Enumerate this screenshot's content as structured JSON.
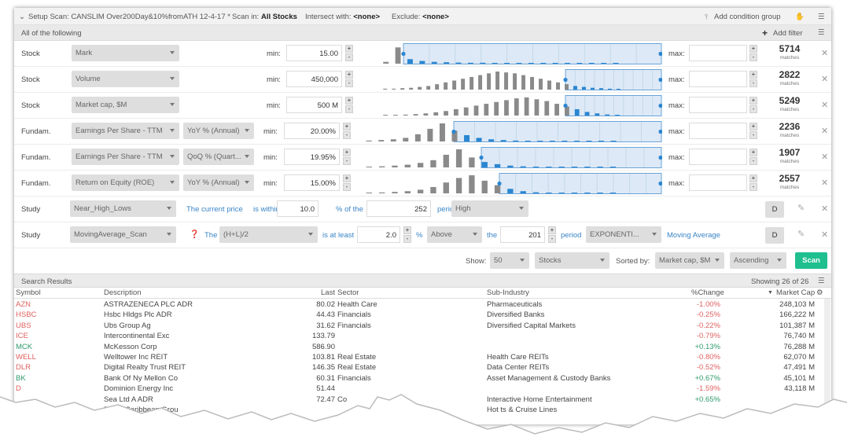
{
  "topbar": {
    "setup_label": "Setup Scan: CANSLIM Over200Day&10%fromATH 12-4-17 *",
    "scan_in_label": "Scan in:",
    "scan_in_value": "All Stocks",
    "intersect_label": "Intersect with:",
    "intersect_value": "<none>",
    "exclude_label": "Exclude:",
    "exclude_value": "<none>",
    "add_group_label": "Add condition group"
  },
  "allbar": {
    "label": "All of the following",
    "add_filter_label": "Add filter"
  },
  "filters": [
    {
      "category": "Stock",
      "field": "Mark",
      "sub": "",
      "min_label": "min:",
      "min": "15.00",
      "max_label": "max:",
      "max": "",
      "matches": "5714",
      "matches_label": "matches"
    },
    {
      "category": "Stock",
      "field": "Volume",
      "sub": "",
      "min_label": "min:",
      "min": "450,000",
      "max_label": "max:",
      "max": "",
      "matches": "2822",
      "matches_label": "matches"
    },
    {
      "category": "Stock",
      "field": "Market cap, $M",
      "sub": "",
      "min_label": "min:",
      "min": "500 M",
      "max_label": "max:",
      "max": "",
      "matches": "5249",
      "matches_label": "matches"
    },
    {
      "category": "Fundam.",
      "field": "Earnings Per Share - TTM",
      "sub": "YoY % (Annual)",
      "min_label": "min:",
      "min": "20.00%",
      "max_label": "max:",
      "max": "",
      "matches": "2236",
      "matches_label": "matches"
    },
    {
      "category": "Fundam.",
      "field": "Earnings Per Share - TTM",
      "sub": "QoQ % (Quart...",
      "min_label": "min:",
      "min": "19.95%",
      "max_label": "max:",
      "max": "",
      "matches": "1907",
      "matches_label": "matches"
    },
    {
      "category": "Fundam.",
      "field": "Return on Equity (ROE)",
      "sub": "YoY % (Annual)",
      "min_label": "min:",
      "min": "15.00%",
      "max_label": "max:",
      "max": "",
      "matches": "2557",
      "matches_label": "matches"
    }
  ],
  "study1": {
    "category": "Study",
    "field": "Near_High_Lows",
    "text1": "The current price",
    "text2": "is within",
    "value": "10.0",
    "text3": "% of the",
    "period_value": "252",
    "period_label": "period",
    "mode": "High",
    "d_label": "D"
  },
  "study2": {
    "category": "Study",
    "field": "MovingAverage_Scan",
    "the_label": "The",
    "source": "(H+L)/2",
    "is_at_least": "is at least",
    "value": "2.0",
    "pct": "%",
    "direction": "Above",
    "the2": "the",
    "period_value": "201",
    "period_label": "period",
    "ma_type": "EXPONENTI...",
    "ma_label": "Moving Average",
    "d_label": "D"
  },
  "show_controls": {
    "show_label": "Show:",
    "show_value": "50",
    "type_value": "Stocks",
    "sorted_label": "Sorted by:",
    "sort_field": "Market cap, $M",
    "sort_order": "Ascending",
    "scan_label": "Scan"
  },
  "results": {
    "title": "Search Results",
    "showing": "Showing 26 of 26",
    "columns": [
      "Symbol",
      "Description",
      "Last",
      "Sector",
      "Sub-Industry",
      "%Change",
      "Market Cap"
    ],
    "rows": [
      {
        "symbol": "AZN",
        "desc": "ASTRAZENECA PLC ADR",
        "last": "80.02",
        "sector": "Health Care",
        "sub": "Pharmaceuticals",
        "chg": "-1.00%",
        "cap": "248,103 M"
      },
      {
        "symbol": "HSBC",
        "desc": "Hsbc Hldgs Plc ADR",
        "last": "44.43",
        "sector": "Financials",
        "sub": "Diversified Banks",
        "chg": "-0.25%",
        "cap": "166,222 M"
      },
      {
        "symbol": "UBS",
        "desc": "Ubs Group Ag",
        "last": "31.62",
        "sector": "Financials",
        "sub": "Diversified Capital Markets",
        "chg": "-0.22%",
        "cap": "101,387 M"
      },
      {
        "symbol": "ICE",
        "desc": "Intercontinental Exc",
        "last": "133.79",
        "sector": "",
        "sub": "",
        "chg": "-0.79%",
        "cap": "76,740 M"
      },
      {
        "symbol": "MCK",
        "desc": "McKesson Corp",
        "last": "586.90",
        "sector": "",
        "sub": "",
        "chg": "+0.13%",
        "cap": "76,288 M"
      },
      {
        "symbol": "WELL",
        "desc": "Welltower Inc REIT",
        "last": "103.81",
        "sector": "Real Estate",
        "sub": "Health Care REITs",
        "chg": "-0.80%",
        "cap": "62,070 M"
      },
      {
        "symbol": "DLR",
        "desc": "Digital Realty Trust REIT",
        "last": "146.35",
        "sector": "Real Estate",
        "sub": "Data Center REITs",
        "chg": "-0.52%",
        "cap": "47,491 M"
      },
      {
        "symbol": "BK",
        "desc": "Bank Of Ny Mellon Co",
        "last": "60.31",
        "sector": "Financials",
        "sub": "Asset Management & Custody Banks",
        "chg": "+0.67%",
        "cap": "45,101 M"
      },
      {
        "symbol": "D",
        "desc": "Dominion Energy Inc",
        "last": "51.44",
        "sector": "",
        "sub": "",
        "chg": "-1.59%",
        "cap": "43,118 M"
      },
      {
        "symbol": "",
        "desc": "Sea Ltd A ADR",
        "last": "72.47",
        "sector": "Co",
        "sub": "Interactive Home Entertainment",
        "chg": "+0.65%",
        "cap": ""
      },
      {
        "symbol": "",
        "desc": "Royal Caribbean Grou",
        "last": "",
        "sector": "",
        "sub": "Hot  ts & Cruise Lines",
        "chg": "",
        "cap": ""
      }
    ]
  },
  "colors": {
    "accent": "#3a85c5",
    "scan": "#1fbf8f",
    "negative": "#e06060",
    "positive": "#2f9a6e"
  }
}
